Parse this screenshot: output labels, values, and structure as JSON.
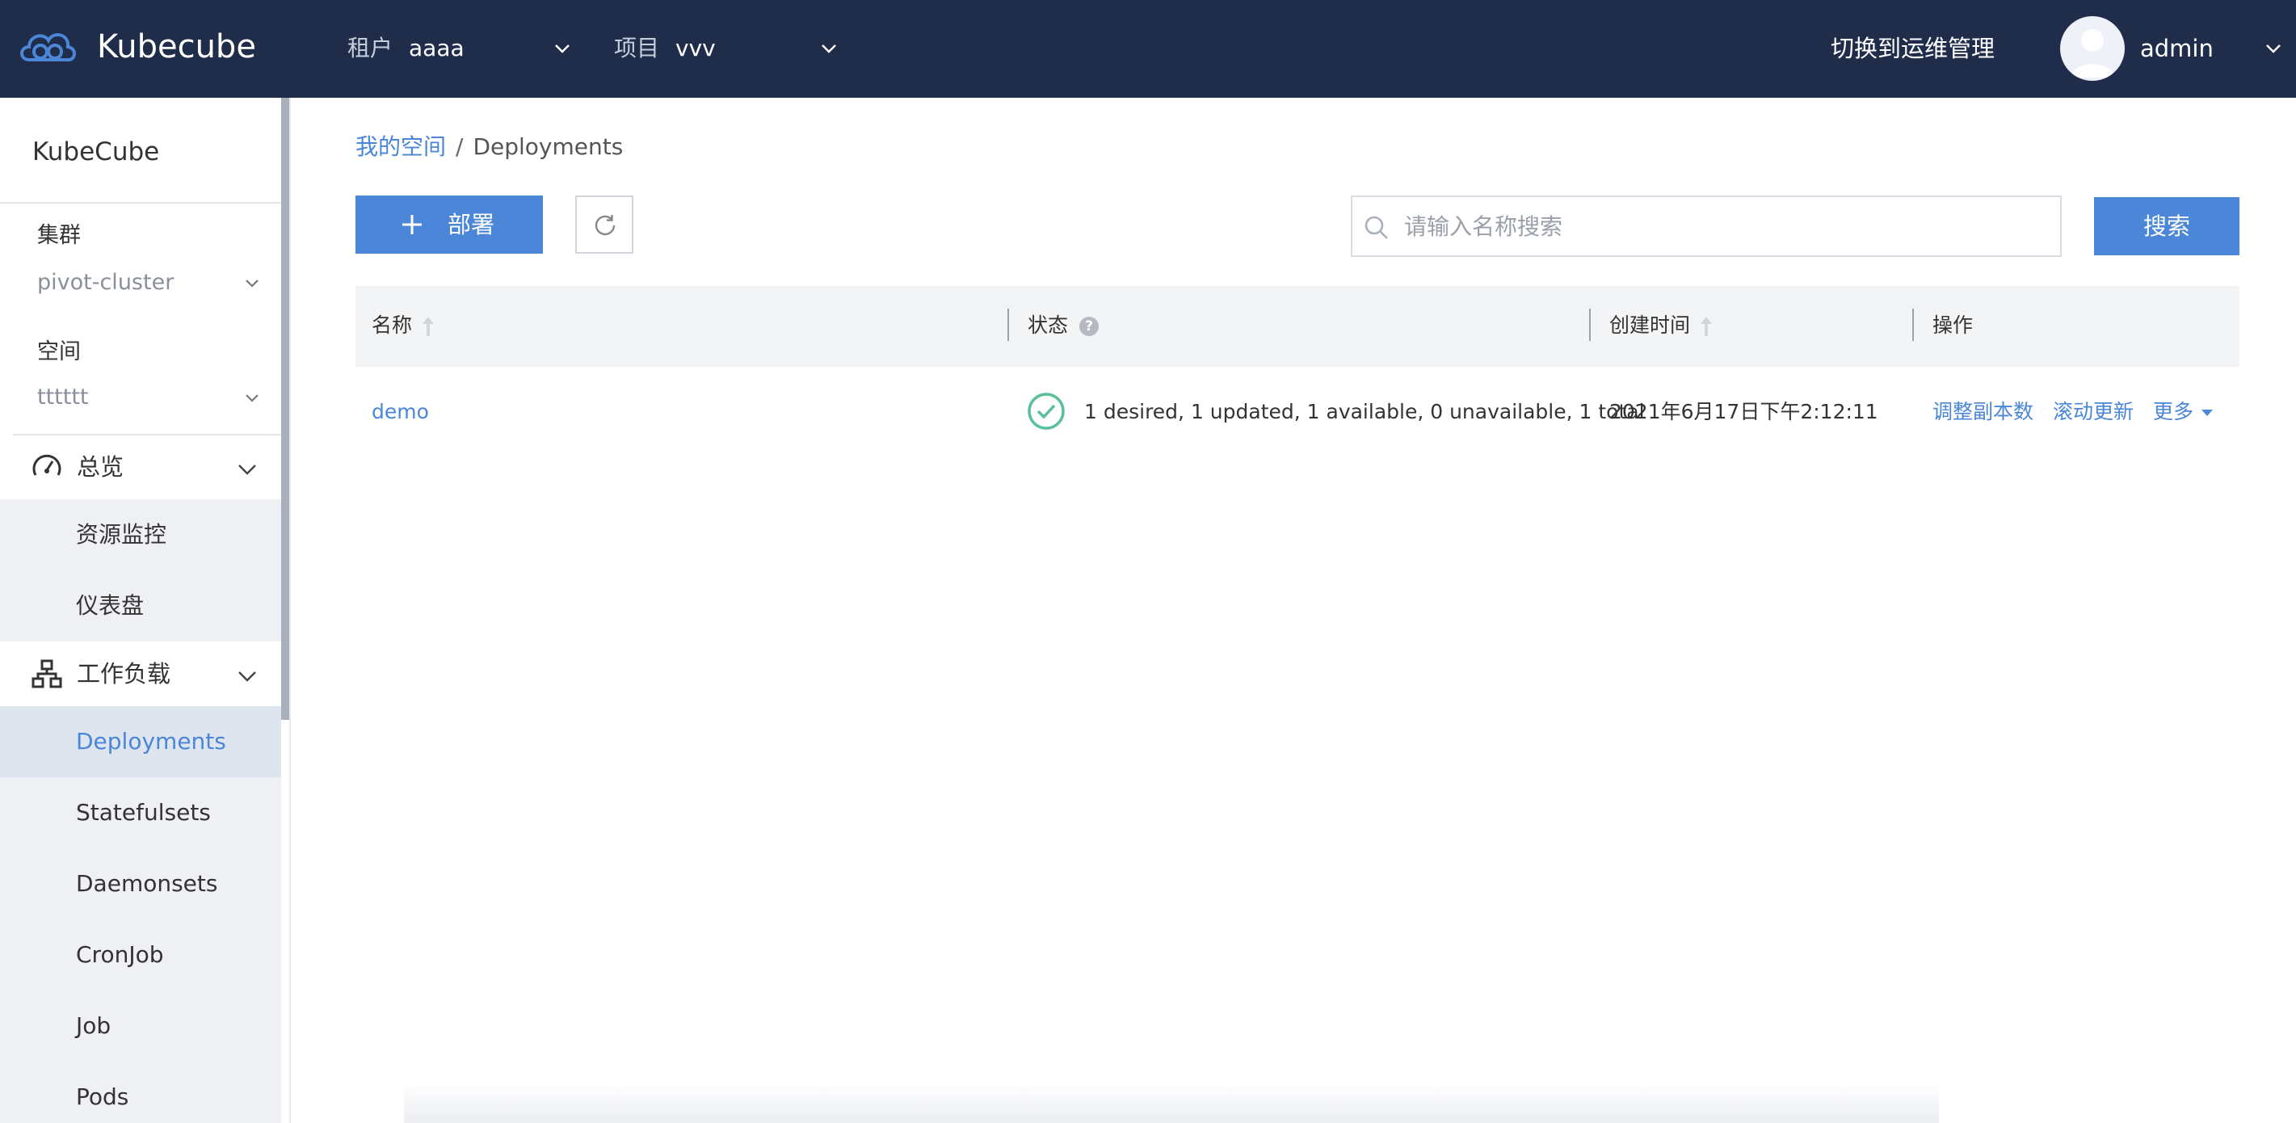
{
  "header": {
    "brand": "Kubecube",
    "tenant": {
      "label": "租户",
      "value": "aaaa"
    },
    "project": {
      "label": "项目",
      "value": "vvv"
    },
    "switch_link": "切换到运维管理",
    "user_name": "admin"
  },
  "sidebar": {
    "title": "KubeCube",
    "cluster_label": "集群",
    "cluster_value": "pivot-cluster",
    "space_label": "空间",
    "space_value": "tttttt",
    "groups": [
      {
        "label": "总览",
        "icon": "dashboard-gauge-icon",
        "items": [
          "资源监控",
          "仪表盘"
        ]
      },
      {
        "label": "工作负载",
        "icon": "workload-tree-icon",
        "items": [
          "Deployments",
          "Statefulsets",
          "Daemonsets",
          "CronJob",
          "Job",
          "Pods"
        ]
      }
    ],
    "active_item": "Deployments"
  },
  "breadcrumb": {
    "root": "我的空间",
    "separator": "/",
    "current": "Deployments"
  },
  "toolbar": {
    "deploy_label": "部署",
    "search_placeholder": "请输入名称搜索",
    "search_value": "",
    "search_button": "搜索"
  },
  "table": {
    "columns": {
      "name": "名称",
      "status": "状态",
      "created": "创建时间",
      "actions": "操作"
    },
    "rows": [
      {
        "name": "demo",
        "status": "1 desired, 1 updated, 1 available, 0 unavailable, 1 total",
        "created": "2021年6月17日下午2:12:11",
        "actions": [
          "调整副本数",
          "滚动更新",
          "更多"
        ]
      }
    ]
  },
  "colors": {
    "header_bg": "#1f2d4b",
    "accent": "#4b86d8",
    "success": "#5bbf98"
  }
}
